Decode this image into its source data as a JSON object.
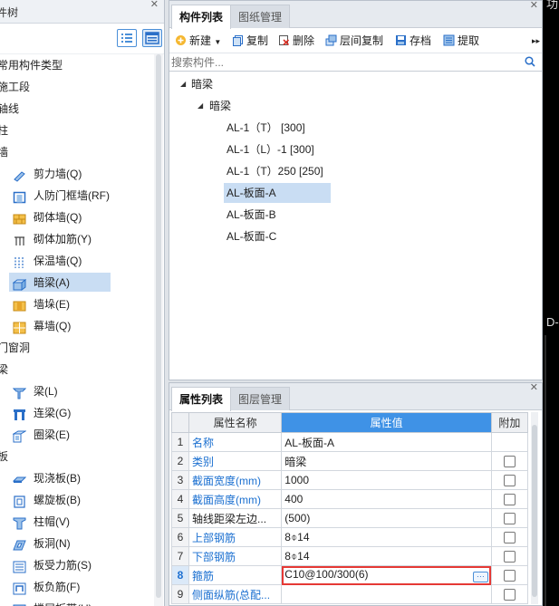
{
  "left_panel": {
    "title": "件树",
    "categories": [
      {
        "label": "常用构件类型",
        "items": []
      },
      {
        "label": "施工段",
        "items": []
      },
      {
        "label": "轴线",
        "items": []
      },
      {
        "label": "柱",
        "items": []
      },
      {
        "label": "墙",
        "items": [
          {
            "label": "剪力墙(Q)",
            "icon": "shear-wall-icon"
          },
          {
            "label": "人防门框墙(RF)",
            "icon": "civil-defense-door-wall-icon"
          },
          {
            "label": "砌体墙(Q)",
            "icon": "masonry-wall-icon"
          },
          {
            "label": "砌体加筋(Y)",
            "icon": "masonry-rebar-icon"
          },
          {
            "label": "保温墙(Q)",
            "icon": "insulation-wall-icon"
          },
          {
            "label": "暗梁(A)",
            "icon": "hidden-beam-icon",
            "selected": true
          },
          {
            "label": "墙垛(E)",
            "icon": "wall-pier-icon"
          },
          {
            "label": "幕墙(Q)",
            "icon": "curtain-wall-icon"
          }
        ]
      },
      {
        "label": "门窗洞",
        "items": []
      },
      {
        "label": "梁",
        "items": [
          {
            "label": "梁(L)",
            "icon": "beam-icon"
          },
          {
            "label": "连梁(G)",
            "icon": "coupling-beam-icon"
          },
          {
            "label": "圈梁(E)",
            "icon": "ring-beam-icon"
          }
        ]
      },
      {
        "label": "板",
        "items": [
          {
            "label": "现浇板(B)",
            "icon": "cast-slab-icon"
          },
          {
            "label": "螺旋板(B)",
            "icon": "spiral-slab-icon"
          },
          {
            "label": "柱帽(V)",
            "icon": "column-cap-icon"
          },
          {
            "label": "板洞(N)",
            "icon": "slab-hole-icon"
          },
          {
            "label": "板受力筋(S)",
            "icon": "slab-main-rebar-icon"
          },
          {
            "label": "板负筋(F)",
            "icon": "slab-negative-rebar-icon"
          },
          {
            "label": "楼层板带(H)",
            "icon": "floor-slab-band-icon"
          }
        ]
      }
    ]
  },
  "component_panel": {
    "tabs": [
      {
        "label": "构件列表",
        "active": true
      },
      {
        "label": "图纸管理",
        "active": false
      }
    ],
    "toolbar": {
      "new_label": "新建",
      "copy_label": "复制",
      "delete_label": "删除",
      "floor_copy_label": "层间复制",
      "save_label": "存档",
      "extract_label": "提取"
    },
    "search_placeholder": "搜索构件...",
    "tree": {
      "root_label": "暗梁",
      "group_label": "暗梁",
      "items": [
        {
          "label": "AL-1（T） [300]",
          "selected": false
        },
        {
          "label": "AL-1（L）-1 [300]",
          "selected": false
        },
        {
          "label": "AL-1（T）250 [250]",
          "selected": false
        },
        {
          "label": "AL-板面-A",
          "selected": true
        },
        {
          "label": "AL-板面-B",
          "selected": false
        },
        {
          "label": "AL-板面-C",
          "selected": false
        }
      ]
    }
  },
  "property_panel": {
    "tabs": [
      {
        "label": "属性列表",
        "active": true
      },
      {
        "label": "图层管理",
        "active": false
      }
    ],
    "headers": {
      "name": "属性名称",
      "value": "属性值",
      "extra": "附加"
    },
    "rows": [
      {
        "num": "1",
        "name": "名称",
        "value": "AL-板面-A",
        "link": true,
        "has_checkbox": false
      },
      {
        "num": "2",
        "name": "类别",
        "value": "暗梁",
        "link": true,
        "has_checkbox": true
      },
      {
        "num": "3",
        "name": "截面宽度(mm)",
        "value": "1000",
        "link": true,
        "has_checkbox": true
      },
      {
        "num": "4",
        "name": "截面高度(mm)",
        "value": "400",
        "link": true,
        "has_checkbox": true
      },
      {
        "num": "5",
        "name": "轴线距梁左边...",
        "value": "(500)",
        "link": false,
        "has_checkbox": true
      },
      {
        "num": "6",
        "name": "上部钢筋",
        "value": "8⌽14",
        "link": true,
        "has_checkbox": true
      },
      {
        "num": "7",
        "name": "下部钢筋",
        "value": "8⌽14",
        "link": true,
        "has_checkbox": true
      },
      {
        "num": "8",
        "name": "箍筋",
        "value": "C10@100/300(6)",
        "link": true,
        "has_checkbox": true,
        "editing": true
      },
      {
        "num": "9",
        "name": "侧面纵筋(总配...",
        "value": "",
        "link": true,
        "has_checkbox": true
      }
    ],
    "ellipsis_label": "···"
  },
  "canvas_strip": {
    "top_text": "功",
    "mid_text": "D-"
  },
  "colors": {
    "accent": "#3f92e6",
    "selection": "#c9ddf3",
    "link": "#1a6fd0",
    "edit_outline": "#e53935"
  }
}
